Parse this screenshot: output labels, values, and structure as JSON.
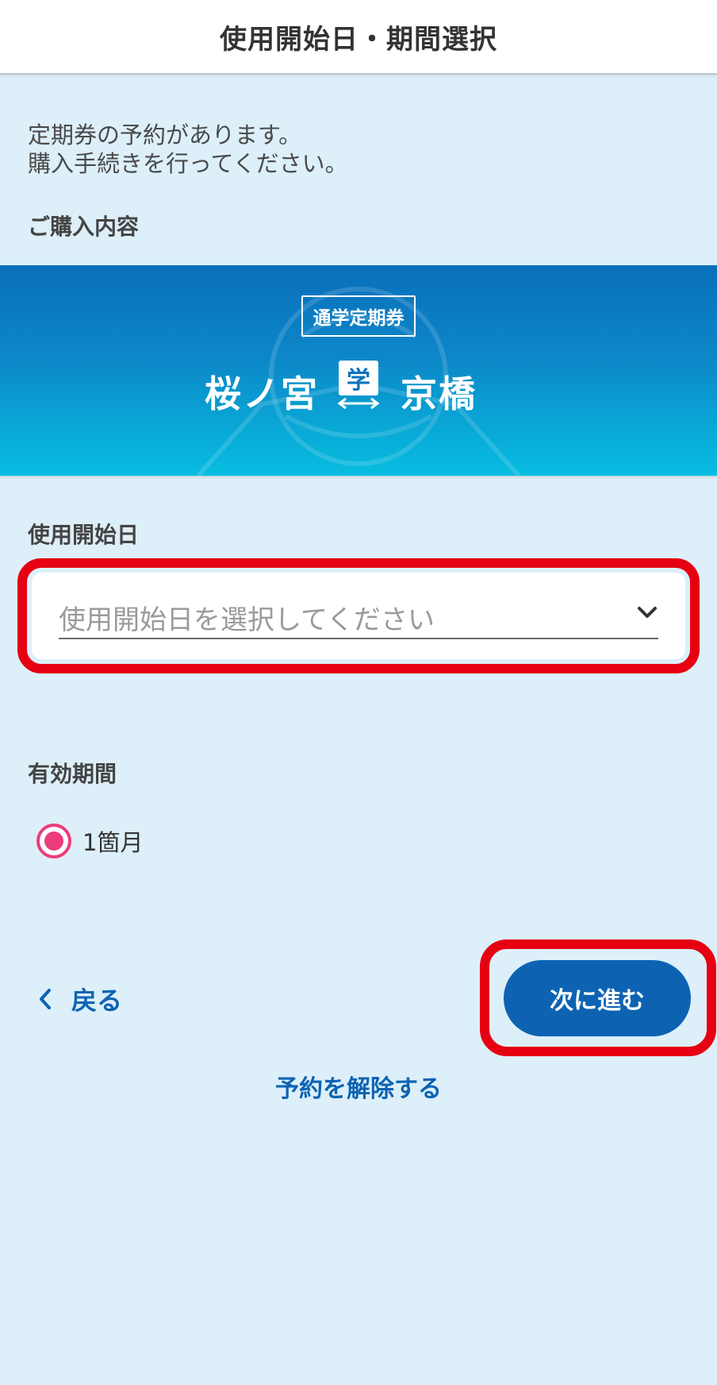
{
  "header": {
    "title": "使用開始日・期間選択"
  },
  "notice": {
    "line1": "定期券の予約があります。",
    "line2": "購入手続きを行ってください。"
  },
  "purchase": {
    "label": "ご購入内容",
    "pass_type": "通学定期券",
    "from_station": "桜ノ宮",
    "student_mark": "学",
    "to_station": "京橋"
  },
  "start_date": {
    "label": "使用開始日",
    "placeholder": "使用開始日を選択してください",
    "icon": "chevron-down-icon"
  },
  "period": {
    "label": "有効期間",
    "options": [
      {
        "label": "1箇月",
        "selected": true
      }
    ]
  },
  "actions": {
    "back_label": "戻る",
    "next_label": "次に進む",
    "cancel_label": "予約を解除する"
  },
  "colors": {
    "background": "#ddeff9",
    "primary": "#0d63b2",
    "radio": "#ec3c7b",
    "highlight": "#e60012",
    "banner_top": "#0a6fbb",
    "banner_bottom": "#07bde0"
  }
}
